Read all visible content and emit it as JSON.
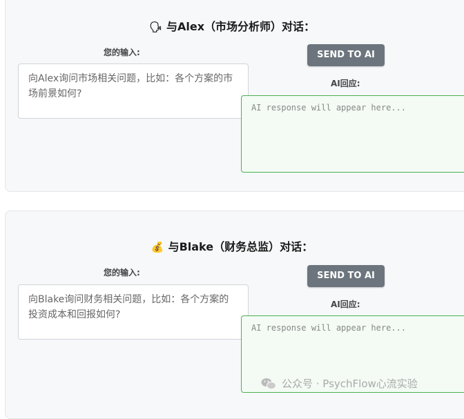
{
  "sections": [
    {
      "icon": "speaking-head-icon",
      "emoji": "🗣",
      "title": "与Alex（市场分析师）对话：",
      "input_label": "您的输入:",
      "input_placeholder": "向Alex询问市场相关问题，比如：各个方案的市场前景如何?",
      "send_label": "SEND TO AI",
      "response_label": "AI回应:",
      "response_placeholder": "AI response will appear here..."
    },
    {
      "icon": "money-bag-icon",
      "emoji": "💰",
      "title": "与Blake（财务总监）对话：",
      "input_label": "您的输入:",
      "input_placeholder": "向Blake询问财务相关问题，比如：各个方案的投资成本和回报如何?",
      "send_label": "SEND TO AI",
      "response_label": "AI回应:",
      "response_placeholder": "AI response will appear here..."
    }
  ],
  "watermark": "公众号 · PsychFlow心流实验"
}
